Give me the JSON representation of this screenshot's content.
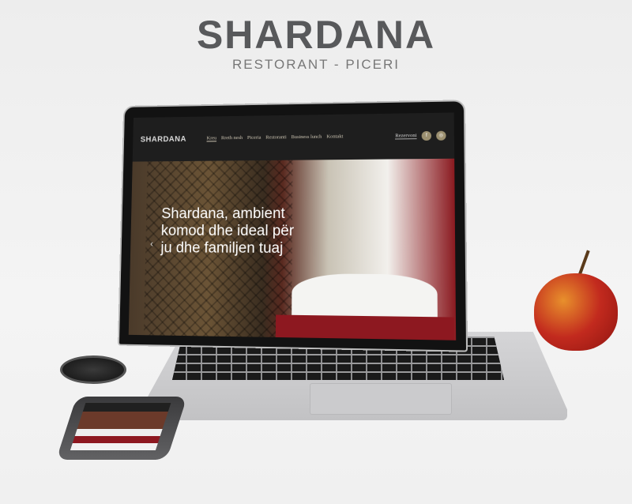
{
  "brand": {
    "title": "SHARDANA",
    "subtitle": "RESTORANT - PICERI"
  },
  "site": {
    "logo": "SHARDANA",
    "nav": [
      {
        "label": "Kreu",
        "active": true
      },
      {
        "label": "Rreth nesh"
      },
      {
        "label": "Piceria"
      },
      {
        "label": "Restoranti"
      },
      {
        "label": "Business lunch"
      },
      {
        "label": "Kontakt"
      }
    ],
    "reserve_label": "Rezervoni",
    "social": [
      {
        "icon": "facebook-icon",
        "glyph": "f"
      },
      {
        "icon": "instagram-icon",
        "glyph": "◎"
      }
    ],
    "hero": {
      "headline": "Shardana, ambient komod dhe ideal për ju dhe familjen tuaj",
      "prev_glyph": "‹"
    }
  },
  "colors": {
    "nav_text": "#cfc7b5",
    "social_bg": "#9c9070",
    "accent_red": "#8d1820"
  }
}
